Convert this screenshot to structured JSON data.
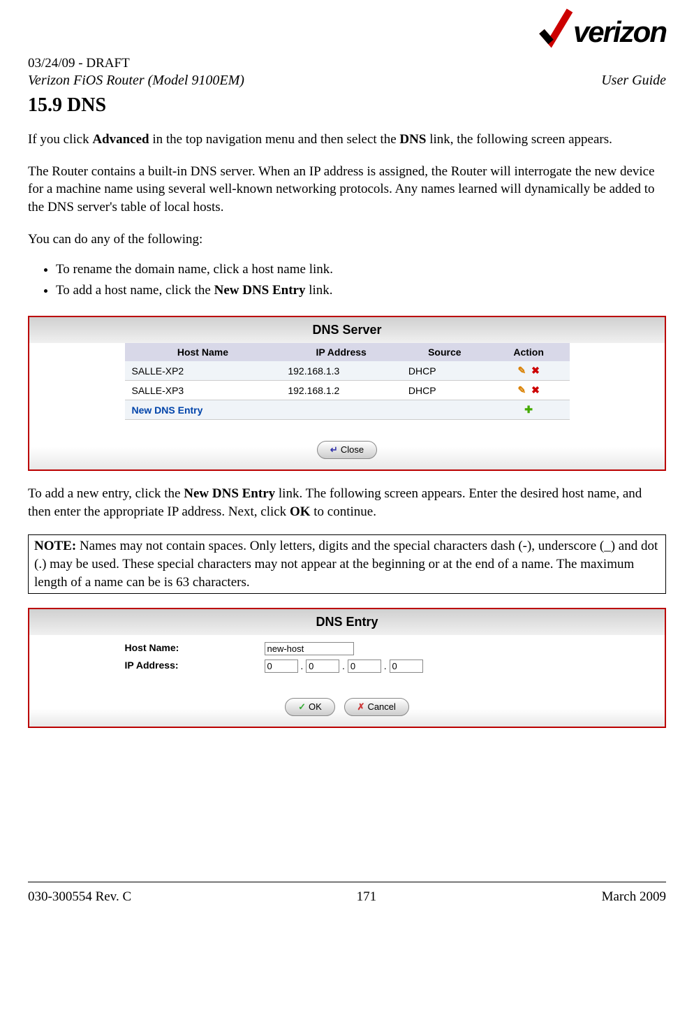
{
  "header": {
    "draft": "03/24/09 - DRAFT",
    "product": "Verizon FiOS Router (Model 9100EM)",
    "doc_type": "User Guide",
    "logo_text": "verizon"
  },
  "section": {
    "number_title": "15.9   DNS"
  },
  "body": {
    "p1_pre": "If you click ",
    "p1_b1": "Advanced",
    "p1_mid": " in the top navigation menu and then select the ",
    "p1_b2": "DNS",
    "p1_post": " link, the following screen appears.",
    "p2": "The Router contains a built-in DNS server. When an IP address is assigned, the Router will interrogate the new device for a machine name using several well-known networking protocols. Any names learned will dynamically be added to the DNS server's table of local hosts.",
    "p3": "You can do any of the following:",
    "li1": "To rename the domain name, click a host name link.",
    "li2_pre": "To add a host name, click the ",
    "li2_b": "New DNS Entry",
    "li2_post": " link.",
    "p4_pre": "To add a new entry, click the ",
    "p4_b1": "New DNS Entry",
    "p4_mid": " link. The following screen appears. Enter the desired host name, and then enter the appropriate IP address. Next, click ",
    "p4_b2": "OK",
    "p4_post": " to continue."
  },
  "note": {
    "label": "NOTE:",
    "text": " Names may not contain spaces. Only letters, digits and the special characters dash (-), underscore (_) and dot (.) may be used. These special characters may not appear at the beginning or at the end of a name. The maximum length of a name can be is 63 characters."
  },
  "screenshot1": {
    "title": "DNS Server",
    "headers": {
      "c1": "Host Name",
      "c2": "IP Address",
      "c3": "Source",
      "c4": "Action"
    },
    "rows": [
      {
        "host": "SALLE-XP2",
        "ip": "192.168.1.3",
        "source": "DHCP"
      },
      {
        "host": "SALLE-XP3",
        "ip": "192.168.1.2",
        "source": "DHCP"
      }
    ],
    "new_entry": "New DNS Entry",
    "close_btn": "Close"
  },
  "screenshot2": {
    "title": "DNS Entry",
    "host_label": "Host Name:",
    "ip_label": "IP Address:",
    "host_value": "new-host",
    "ip": {
      "a": "0",
      "b": "0",
      "c": "0",
      "d": "0"
    },
    "ok_btn": "OK",
    "cancel_btn": "Cancel"
  },
  "footer": {
    "left": "030-300554 Rev. C",
    "center": "171",
    "right": "March 2009"
  }
}
